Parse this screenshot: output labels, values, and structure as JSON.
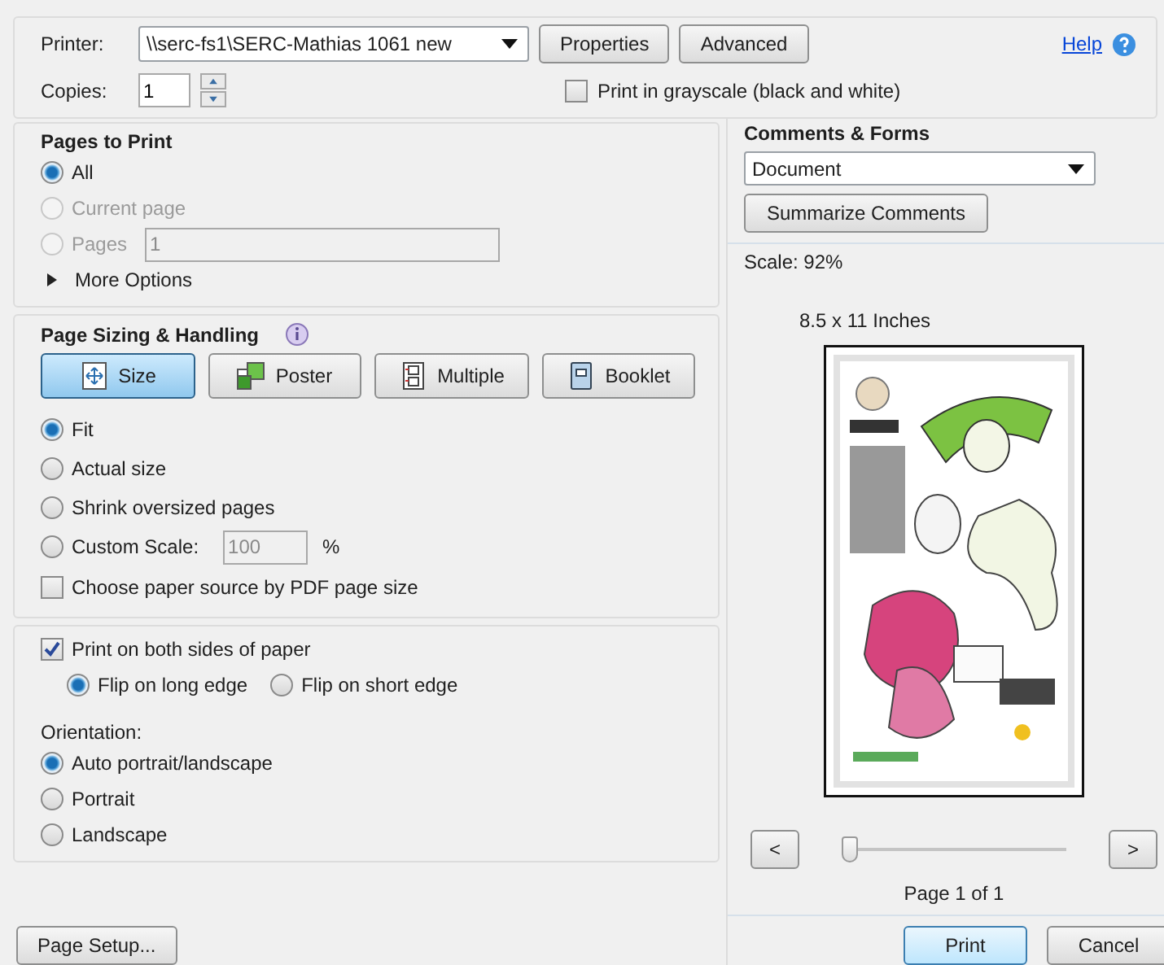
{
  "printer": {
    "label": "Printer:",
    "value": "\\\\serc-fs1\\SERC-Mathias 1061 new",
    "buttons": [
      "Properties",
      "Advanced"
    ]
  },
  "help": "Help",
  "copies": {
    "label": "Copies:",
    "value": "1"
  },
  "grayscale": {
    "label": "Print in grayscale (black and white)",
    "checked": false
  },
  "pages_to_print": {
    "title": "Pages to Print",
    "options": [
      {
        "label": "All",
        "selected": true,
        "disabled": false
      },
      {
        "label": "Current page",
        "selected": false,
        "disabled": true
      },
      {
        "label": "Pages",
        "selected": false,
        "disabled": true,
        "value": "1"
      }
    ],
    "more_options": "More Options"
  },
  "page_sizing": {
    "title": "Page Sizing & Handling",
    "modes": [
      {
        "label": "Size",
        "kind": "size",
        "selected": true
      },
      {
        "label": "Poster",
        "kind": "poster",
        "selected": false
      },
      {
        "label": "Multiple",
        "kind": "multiple",
        "selected": false
      },
      {
        "label": "Booklet",
        "kind": "booklet",
        "selected": false
      }
    ],
    "options": [
      {
        "label": "Fit",
        "selected": true
      },
      {
        "label": "Actual size",
        "selected": false
      },
      {
        "label": "Shrink oversized pages",
        "selected": false
      },
      {
        "label": "Custom Scale:",
        "selected": false,
        "value": "100",
        "suffix": "%"
      }
    ],
    "paper_source": {
      "label": "Choose paper source by PDF page size",
      "checked": false
    }
  },
  "duplex": {
    "label": "Print on both sides of paper",
    "checked": true,
    "flips": [
      {
        "label": "Flip on long edge",
        "selected": true
      },
      {
        "label": "Flip on short edge",
        "selected": false
      }
    ]
  },
  "orientation": {
    "label": "Orientation:",
    "options": [
      {
        "label": "Auto portrait/landscape",
        "selected": true
      },
      {
        "label": "Portrait",
        "selected": false
      },
      {
        "label": "Landscape",
        "selected": false
      }
    ]
  },
  "page_setup": "Page Setup...",
  "comments_forms": {
    "title": "Comments & Forms",
    "value": "Document",
    "button": "Summarize Comments"
  },
  "preview": {
    "scale": "Scale:  92%",
    "paper": "8.5 x 11 Inches",
    "prev": "<",
    "next": ">",
    "level": 0,
    "page_label": "Page 1 of 1"
  },
  "actions": [
    {
      "label": "Print",
      "default": true
    },
    {
      "label": "Cancel",
      "default": false
    }
  ]
}
